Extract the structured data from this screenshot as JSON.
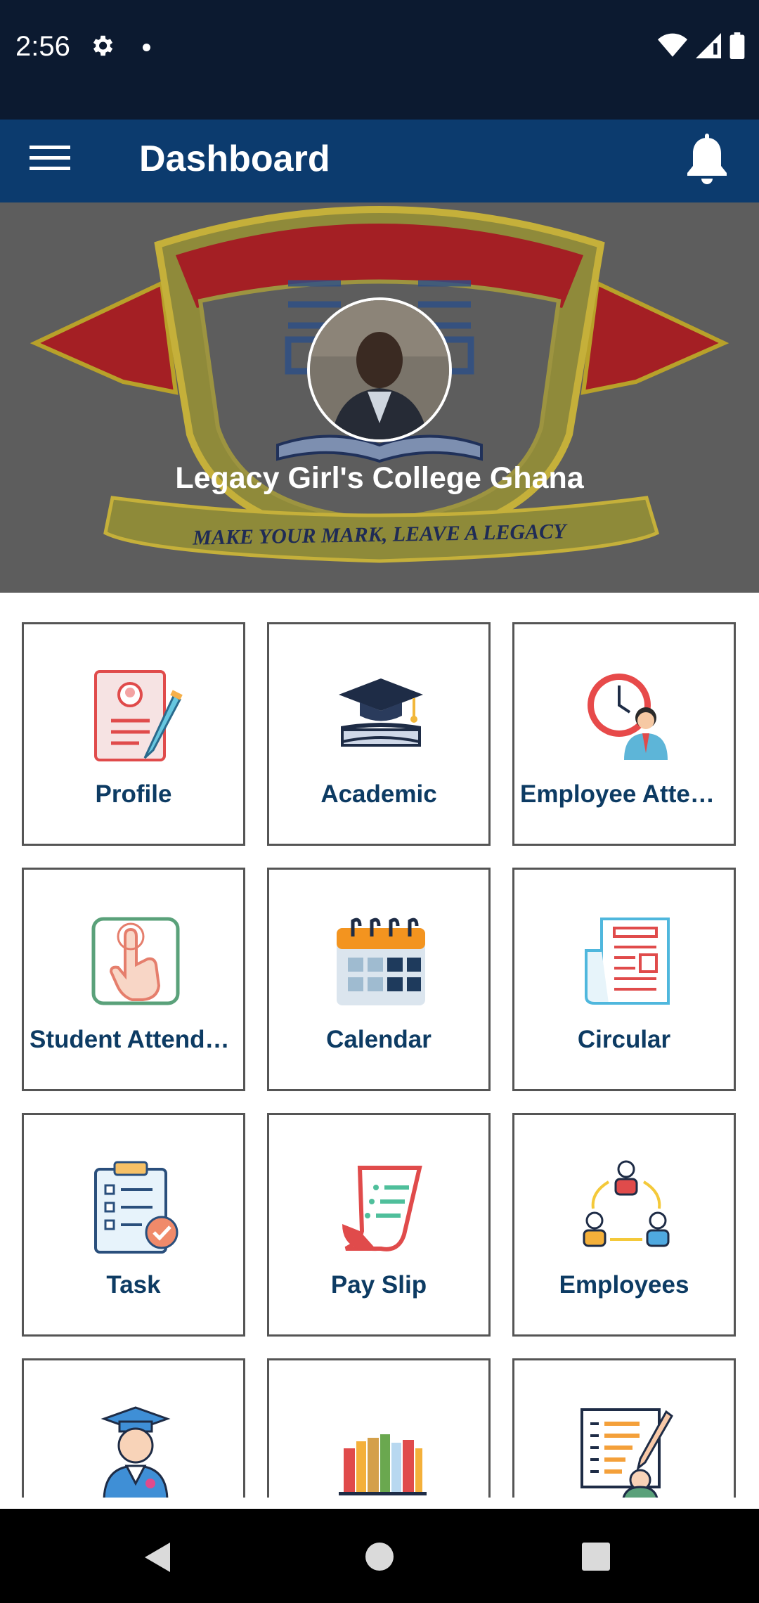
{
  "status_bar": {
    "time": "2:56",
    "icons": [
      "gear-icon",
      "dot-icon",
      "wifi-icon",
      "signal-icon",
      "battery-icon"
    ]
  },
  "app_bar": {
    "title": "Dashboard",
    "menu_icon": "hamburger-menu-icon",
    "notification_icon": "bell-icon"
  },
  "banner": {
    "college_name": "Legacy Girl's College  Ghana",
    "motto": "MAKE YOUR MARK, LEAVE A LEGACY"
  },
  "tiles": [
    {
      "label": "Profile",
      "icon": "profile-icon"
    },
    {
      "label": "Academic",
      "icon": "graduation-cap-icon"
    },
    {
      "label": "Employee Atten…",
      "icon": "employee-attendance-icon"
    },
    {
      "label": "Student Attenda…",
      "icon": "student-attendance-icon"
    },
    {
      "label": "Calendar",
      "icon": "calendar-icon"
    },
    {
      "label": "Circular",
      "icon": "circular-icon"
    },
    {
      "label": "Task",
      "icon": "task-icon"
    },
    {
      "label": "Pay Slip",
      "icon": "payslip-icon"
    },
    {
      "label": "Employees",
      "icon": "employees-icon"
    },
    {
      "label": "",
      "icon": "graduate-icon"
    },
    {
      "label": "",
      "icon": "library-icon"
    },
    {
      "label": "",
      "icon": "exam-icon"
    }
  ],
  "nav_bar": {
    "icons": [
      "back-icon",
      "home-icon",
      "recents-icon"
    ]
  },
  "colors": {
    "status_bar": "#0c1a30",
    "app_bar": "#0c3b6e",
    "tile_label": "#0d3b63",
    "banner": "#5d5d5d"
  }
}
